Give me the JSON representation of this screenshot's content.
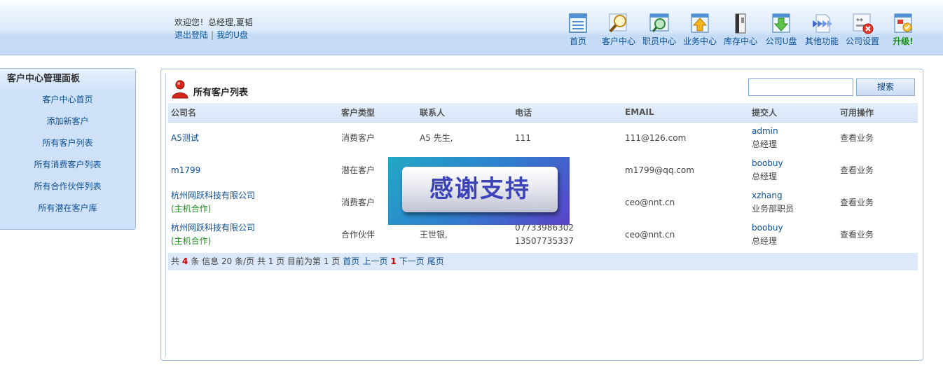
{
  "header": {
    "welcome": "欢迎您！总经理,夏韬",
    "logout": "退出登陆",
    "separator": "|",
    "my_disk": "我的U盘",
    "nav": [
      {
        "label": "首页",
        "icon": "document-list-icon"
      },
      {
        "label": "客户中心",
        "icon": "magnifier-icon"
      },
      {
        "label": "职员中心",
        "icon": "refresh-search-icon"
      },
      {
        "label": "业务中心",
        "icon": "upload-arrow-icon"
      },
      {
        "label": "库存中心",
        "icon": "binder-icon"
      },
      {
        "label": "公司U盘",
        "icon": "download-arrow-icon"
      },
      {
        "label": "其他功能",
        "icon": "forward-arrows-icon"
      },
      {
        "label": "公司设置",
        "icon": "settings-window-icon"
      },
      {
        "label": "升级!",
        "icon": "upgrade-icon"
      }
    ]
  },
  "sidebar": {
    "title": "客户中心管理面板",
    "items": [
      {
        "label": "客户中心首页"
      },
      {
        "label": "添加新客户"
      },
      {
        "label": "所有客户列表"
      },
      {
        "label": "所有消费客户列表"
      },
      {
        "label": "所有合作伙伴列表"
      },
      {
        "label": "所有潜在客户库"
      }
    ]
  },
  "main": {
    "title": "所有客户列表",
    "search_button": "搜索",
    "search_value": "",
    "columns": [
      "公司名",
      "客户类型",
      "联系人",
      "电话",
      "EMAIL",
      "提交人",
      "可用操作"
    ],
    "rows": [
      {
        "company": "A5测试",
        "company_note": "",
        "type": "消费客户",
        "contact": "A5 先生,",
        "phone1": "111",
        "phone2": "",
        "email": "111@126.com",
        "submitter": "admin",
        "role": "总经理",
        "op1": "查看",
        "op2": "业务"
      },
      {
        "company": "m1799",
        "company_note": "",
        "type": "潜在客户",
        "contact": "",
        "phone1": "",
        "phone2": "",
        "email": "m1799@qq.com",
        "submitter": "boobuy",
        "role": "总经理",
        "op1": "查看",
        "op2": "业务"
      },
      {
        "company": "杭州网跃科技有限公司",
        "company_note": "(主机合作)",
        "type": "消费客户",
        "contact": "",
        "phone1": "",
        "phone2": "",
        "email": "ceo@nnt.cn",
        "submitter": "xzhang",
        "role": "业务部职员",
        "op1": "查看",
        "op2": "业务"
      },
      {
        "company": "杭州网跃科技有限公司",
        "company_note": "(主机合作)",
        "type": "合作伙伴",
        "contact": "王世银,",
        "phone1": "07733986302",
        "phone2": "13507735337",
        "email": "ceo@nnt.cn",
        "submitter": "boobuy",
        "role": "总经理",
        "op1": "查看",
        "op2": "业务"
      }
    ],
    "pager": {
      "t1": "共",
      "total": "4",
      "t2": "条 信息 20 条/页 共 1 页 目前为第 1 页",
      "first": "首页",
      "prev": "上一页",
      "current": "1",
      "next": "下一页",
      "last": "尾页"
    }
  },
  "banner": {
    "text": "感谢支持"
  },
  "colors": {
    "link": "#0b4f94",
    "accent_red": "#d10000",
    "green": "#199119",
    "panel_border": "#9cbde0"
  }
}
